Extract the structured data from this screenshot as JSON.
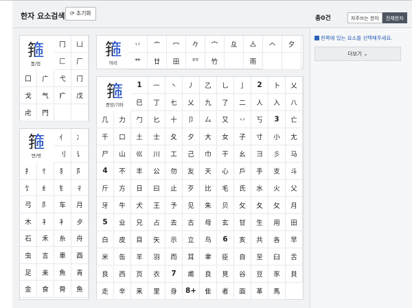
{
  "header": {
    "title": "한자 요소검색",
    "reset_label": "초기화",
    "reset_icon": "refresh-icon"
  },
  "results": {
    "count_label": "총0건",
    "tabs": [
      {
        "label": "자주쓰는 한자",
        "active": false
      },
      {
        "label": "전체한자",
        "active": true
      }
    ],
    "hint": "왼쪽에 있는 요소를 선택해주세요.",
    "more_label": "더보기",
    "more_icon": "chevron-down-icon"
  },
  "sections": {
    "enclosure": {
      "glyph": "箍",
      "label": "몸/엄",
      "cells": [
        "冂",
        "凵",
        "匚",
        "厂",
        "囗",
        "广",
        "弋",
        "门",
        "戈",
        "气",
        "疒",
        "戊",
        "虍",
        "門",
        "",
        ""
      ]
    },
    "top": {
      "glyph": "箍",
      "label": "머리",
      "cells": [
        "丷",
        "亠",
        "冖",
        "𠂊",
        "宀",
        "彑",
        "亼",
        "𠆢",
        "夕",
        "艹",
        "廿",
        "田",
        "㓁",
        "竹",
        "𫝀",
        "雨",
        "",
        ""
      ]
    },
    "side": {
      "glyph": "箍",
      "label": "변/방",
      "cells": [
        "亻",
        "冫",
        "刂",
        "讠",
        "扌",
        "忄",
        "犭",
        "阝",
        "饣",
        "纟",
        "钅",
        "彳",
        "弓",
        "阝",
        "车",
        "月",
        "木",
        "礻",
        "衤",
        "歺",
        "石",
        "禾",
        "糸",
        "舟",
        "虫",
        "言",
        "車",
        "酉",
        "足",
        "耒",
        "魚",
        "青",
        "金",
        "食",
        "骨",
        "魚"
      ]
    },
    "etc": {
      "glyph": "箍",
      "label": "중앙/기타",
      "cells": [
        "1",
        "一",
        "丶",
        "丿",
        "乙",
        "乚",
        "亅",
        "2",
        "卜",
        "乂",
        "巳",
        "丁",
        "七",
        "乂",
        "九",
        "了",
        "二",
        "人",
        "入",
        "八",
        "几",
        "力",
        "勹",
        "匕",
        "十",
        "卩",
        "厶",
        "又",
        "丷",
        "丂",
        "3",
        "亡",
        "千",
        "口",
        "土",
        "士",
        "夂",
        "夕",
        "大",
        "女",
        "子",
        "寸",
        "小",
        "尢",
        "尸",
        "山",
        "巛",
        "川",
        "工",
        "己",
        "巾",
        "干",
        "幺",
        "彐",
        "彡",
        "马",
        "4",
        "不",
        "丰",
        "公",
        "勿",
        "友",
        "天",
        "心",
        "戶",
        "手",
        "支",
        "斗",
        "斤",
        "方",
        "日",
        "曰",
        "止",
        "歹",
        "比",
        "毛",
        "氏",
        "水",
        "火",
        "父",
        "牙",
        "牛",
        "犬",
        "王",
        "予",
        "见",
        "朱",
        "贝",
        "攵",
        "夂",
        "攵",
        "月",
        "5",
        "业",
        "兄",
        "占",
        "去",
        "古",
        "母",
        "玄",
        "甘",
        "生",
        "用",
        "田",
        "白",
        "皮",
        "目",
        "矢",
        "示",
        "立",
        "鸟",
        "6",
        "亥",
        "共",
        "各",
        "早",
        "米",
        "缶",
        "羊",
        "羽",
        "而",
        "耳",
        "聿",
        "臣",
        "自",
        "至",
        "臼",
        "舌",
        "良",
        "西",
        "页",
        "衣",
        "7",
        "甫",
        "良",
        "見",
        "谷",
        "豆",
        "豕",
        "貝",
        "走",
        "辛",
        "釆",
        "里",
        "身",
        "8+",
        "隹",
        "者",
        "面",
        "革",
        "馬"
      ]
    }
  }
}
